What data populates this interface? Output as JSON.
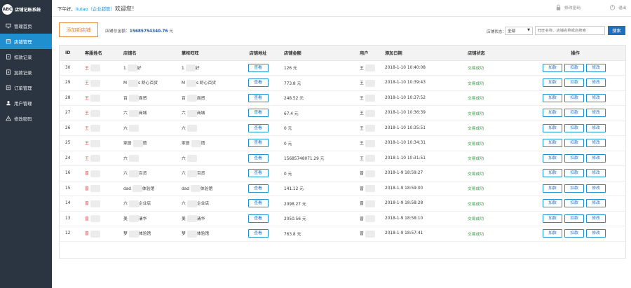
{
  "brand": {
    "logo_text": "ABC",
    "title": "店铺记账系统"
  },
  "sidebar": {
    "items": [
      {
        "label": "管理首页",
        "icon": "monitor-icon",
        "active": false
      },
      {
        "label": "店铺管理",
        "icon": "store-icon",
        "active": true
      },
      {
        "label": "扣款记录",
        "icon": "minus-doc-icon",
        "active": false
      },
      {
        "label": "加款记录",
        "icon": "plus-doc-icon",
        "active": false
      },
      {
        "label": "订单管理",
        "icon": "order-icon",
        "active": false
      },
      {
        "label": "用户管理",
        "icon": "user-icon",
        "active": false
      },
      {
        "label": "修改密码",
        "icon": "warning-icon",
        "active": false
      }
    ]
  },
  "header": {
    "greeting_prefix": "下午好，",
    "username": "liutao（企业超管）",
    "welcome": "欢迎您！",
    "change_password": "修改密码",
    "logout": "退出"
  },
  "toolbar": {
    "add_shop": "添加新店铺",
    "total_label": "店铺总金额：",
    "total_value": "15685754340.76",
    "total_unit": "元",
    "status_label": "店铺状态：",
    "status_selected": "全部",
    "search_placeholder": "旺旺名称、店铺名称或店搜索",
    "search_button": "搜索"
  },
  "table": {
    "columns": [
      "ID",
      "客服姓名",
      "店铺名",
      "掌柜旺旺",
      "店铺地址",
      "店铺金额",
      "用户",
      "添加日期",
      "店铺状态",
      "操作"
    ],
    "view_label": "查看",
    "actions": [
      "加款",
      "扣款",
      "修改"
    ],
    "rows": [
      {
        "id": "30",
        "staff": "王",
        "shop": "1",
        "shop_suffix": "好",
        "wangwang": "1",
        "ww_suffix": "好",
        "amount": "126 元",
        "user": "王",
        "date": "2018-1-10 10:40:08",
        "status": "交易成功"
      },
      {
        "id": "29",
        "staff": "王",
        "shop": "M",
        "shop_suffix": "s 舒心百货",
        "wangwang": "M",
        "ww_suffix": "s 舒心百货",
        "amount": "773.8 元",
        "user": "王",
        "date": "2018-1-10 10:39:43",
        "status": "交易成功"
      },
      {
        "id": "28",
        "staff": "王",
        "shop": "百",
        "shop_suffix": "商贸",
        "wangwang": "百",
        "ww_suffix": "商贸",
        "amount": "248.52 元",
        "user": "王",
        "date": "2018-1-10 10:37:52",
        "status": "交易成功"
      },
      {
        "id": "27",
        "staff": "王",
        "shop": "六",
        "shop_suffix": "商城",
        "wangwang": "六",
        "ww_suffix": "商城",
        "amount": "67.4 元",
        "user": "王",
        "date": "2018-1-10 10:36:39",
        "status": "交易成功"
      },
      {
        "id": "26",
        "staff": "王",
        "shop": "六",
        "shop_suffix": "",
        "wangwang": "六",
        "ww_suffix": "",
        "amount": "0 元",
        "user": "王",
        "date": "2018-1-10 10:35:51",
        "status": "交易成功"
      },
      {
        "id": "25",
        "staff": "王",
        "shop": "家居",
        "shop_suffix": "馆",
        "wangwang": "家居",
        "ww_suffix": "馆",
        "amount": "0 元",
        "user": "王",
        "date": "2018-1-10 10:34:31",
        "status": "交易成功"
      },
      {
        "id": "24",
        "staff": "王",
        "shop": "六",
        "shop_suffix": "",
        "wangwang": "六",
        "ww_suffix": "",
        "amount": "15685748071.29 元",
        "user": "王",
        "date": "2018-1-10 10:31:51",
        "status": "交易成功"
      },
      {
        "id": "16",
        "staff": "曾",
        "shop": "六",
        "shop_suffix": "百货",
        "wangwang": "六",
        "ww_suffix": "百货",
        "amount": "0 元",
        "user": "曾",
        "date": "2018-1-9 18:59:27",
        "status": "交易成功"
      },
      {
        "id": "15",
        "staff": "曾",
        "shop": "dad",
        "shop_suffix": "体验馆",
        "wangwang": "dad",
        "ww_suffix": "体验馆",
        "amount": "141.12 元",
        "user": "曾",
        "date": "2018-1-9 18:59:00",
        "status": "交易成功"
      },
      {
        "id": "14",
        "staff": "曾",
        "shop": "六",
        "shop_suffix": "企业店",
        "wangwang": "六",
        "ww_suffix": "企业店",
        "amount": "2098.27 元",
        "user": "曾",
        "date": "2018-1-9 18:58:28",
        "status": "交易成功"
      },
      {
        "id": "13",
        "staff": "曾",
        "shop": "美",
        "shop_suffix": "清华",
        "wangwang": "美",
        "ww_suffix": "清华",
        "amount": "2050.56 元",
        "user": "曾",
        "date": "2018-1-9 18:58:10",
        "status": "交易成功"
      },
      {
        "id": "12",
        "staff": "曾",
        "shop": "梦",
        "shop_suffix": "体验馆",
        "wangwang": "梦",
        "ww_suffix": "体验馆",
        "amount": "763.8 元",
        "user": "曾",
        "date": "2018-1-9 18:57:41",
        "status": "交易成功"
      }
    ]
  },
  "colors": {
    "sidebar_bg": "#2b3541",
    "active": "#1f8fd0",
    "accent_orange": "#e08a3a",
    "success": "#2e9a3c",
    "staff_red": "#dd3333"
  }
}
